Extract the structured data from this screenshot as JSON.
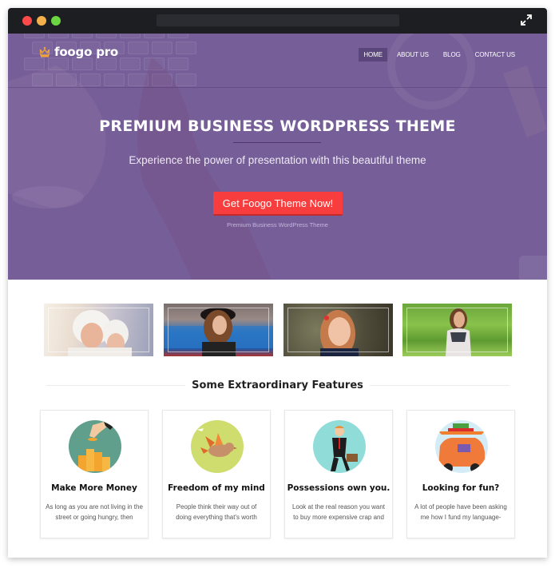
{
  "window": {
    "traffic_lights": [
      "close",
      "minimize",
      "maximize"
    ],
    "expand_icon": "expand-arrows-icon"
  },
  "header": {
    "logo_text": "foogo pro",
    "logo_icon": "crown-icon",
    "nav": [
      {
        "label": "HOME",
        "active": true
      },
      {
        "label": "ABOUT US",
        "active": false
      },
      {
        "label": "BLOG",
        "active": false
      },
      {
        "label": "CONTACT US",
        "active": false
      }
    ]
  },
  "hero": {
    "title": "PREMIUM BUSINESS WORDPRESS THEME",
    "subtitle": "Experience the power of presentation with this beautiful theme",
    "cta_label": "Get Foogo Theme Now!",
    "cta_caption": "Premium Business WordPress Theme",
    "colors": {
      "overlay": "#765f98",
      "cta": "#f73d3d"
    }
  },
  "gallery": {
    "images": [
      {
        "name": "mother-and-child-winter"
      },
      {
        "name": "woman-black-hat-train"
      },
      {
        "name": "smiling-girl"
      },
      {
        "name": "woman-in-orchard"
      }
    ]
  },
  "features": {
    "heading": "Some Extraordinary Features",
    "cards": [
      {
        "title": "Make More Money",
        "text": "As long as you are not living in the street or going hungry, then",
        "icon": "coins-hand-icon"
      },
      {
        "title": "Freedom of my mind",
        "text": "People think their way out of doing everything that's worth",
        "icon": "bird-icon"
      },
      {
        "title": "Possessions own you.",
        "text": "Look at the real reason you want to buy more expensive crap and",
        "icon": "businessman-icon"
      },
      {
        "title": "Looking for fun?",
        "text": "A lot of people have been asking me how I fund my language-",
        "icon": "car-travel-icon"
      }
    ]
  }
}
